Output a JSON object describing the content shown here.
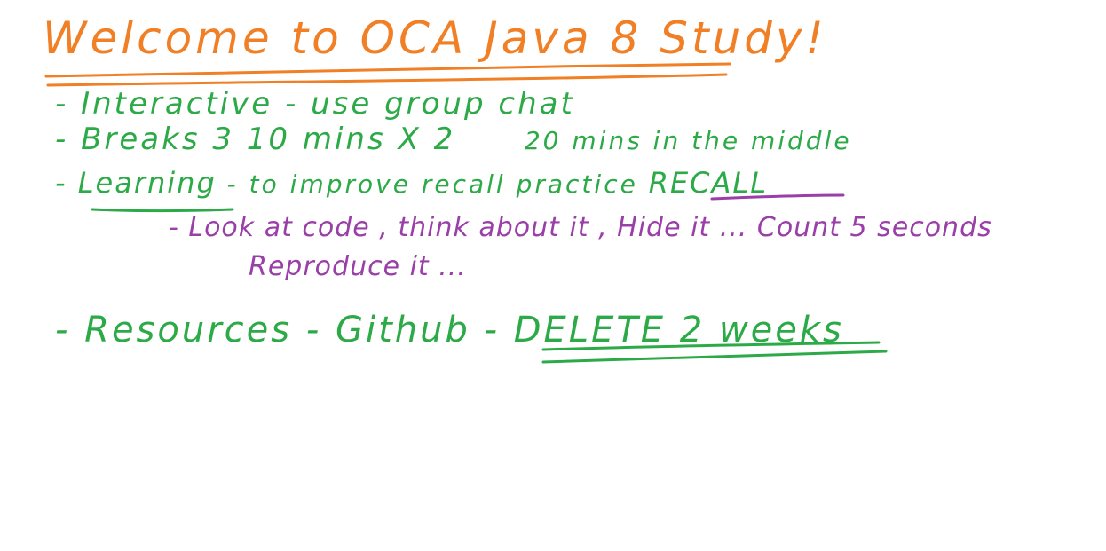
{
  "canvas": {
    "background": "#ffffff",
    "ink_colors": {
      "title": "#F07F25",
      "bullets": "#2DAA48",
      "notes": "#9A3FA8"
    }
  },
  "title": "Welcome to OCA Java 8 Study!",
  "bullets": {
    "interactive": "- Interactive - use group chat",
    "breaks_main": "- Breaks  3  10 mins X 2",
    "breaks_extra": "20 mins in the middle",
    "learning_prefix": "- ",
    "learning_word": "Learning",
    "learning_rest": " - to improve recall practice ",
    "recall": "RECALL",
    "resources_prefix": "- Resources - Github - ",
    "delete_note": "DELETE 2 weeks"
  },
  "notes": {
    "look_at_code": "- Look at code , think about it , Hide it ... Count 5 seconds",
    "reproduce": "Reproduce it ..."
  }
}
